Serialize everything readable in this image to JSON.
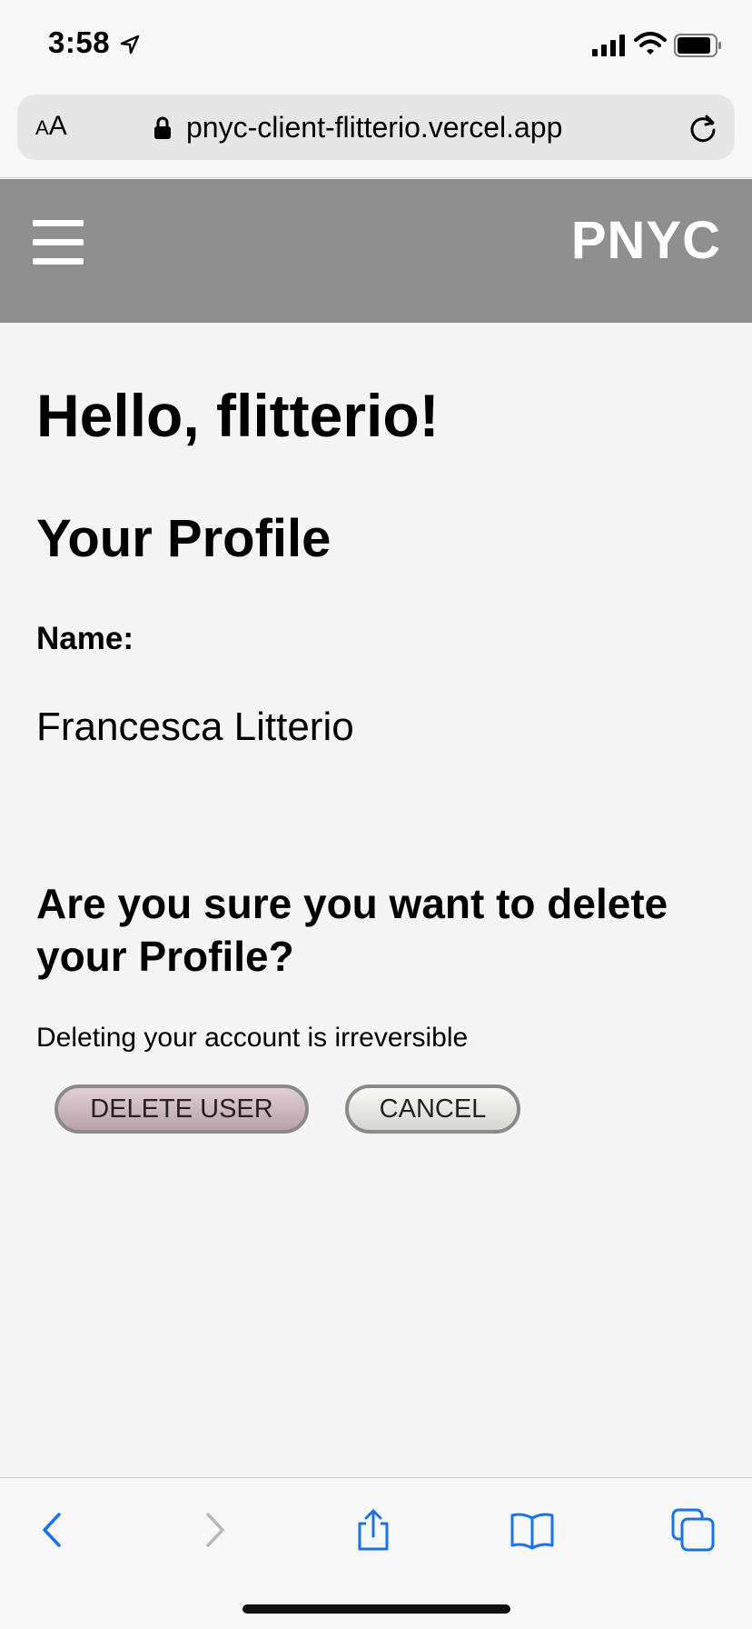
{
  "status_bar": {
    "time": "3:58",
    "icons": [
      "location-arrow-icon",
      "signal-icon",
      "wifi-icon",
      "battery-icon"
    ]
  },
  "browser": {
    "aa_label_small": "A",
    "aa_label_large": "A",
    "url": "pnyc-client-flitterio.vercel.app",
    "icons": [
      "lock-icon",
      "reload-icon"
    ]
  },
  "header": {
    "brand": "PNYC",
    "menu_icon": "hamburger-menu-icon",
    "background": "#8f8f8f"
  },
  "main": {
    "greeting": "Hello, flitterio!",
    "section_title": "Your Profile",
    "name_label": "Name:",
    "name_value": "Francesca Litterio",
    "confirm_title": "Are you sure you want to delete your Profile?",
    "warning": "Deleting your account is irreversible",
    "delete_button": "DELETE USER",
    "cancel_button": "CANCEL"
  },
  "toolbar": {
    "icons": [
      "back-icon",
      "forward-icon",
      "share-icon",
      "bookmarks-icon",
      "tabs-icon"
    ],
    "accent": "#1a73e8"
  }
}
